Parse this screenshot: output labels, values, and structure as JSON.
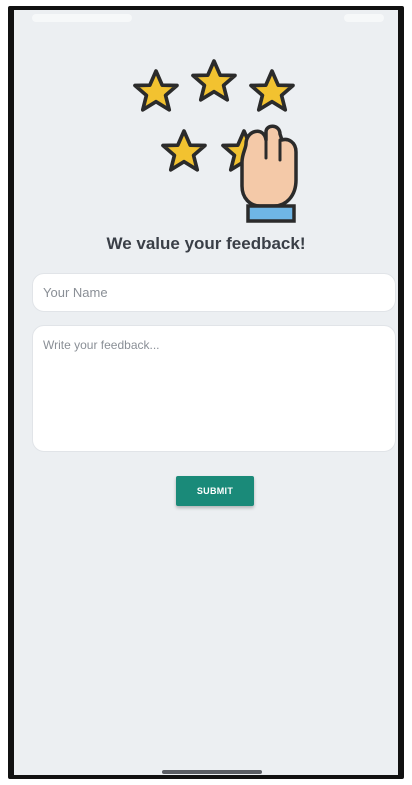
{
  "page": {
    "title": "We value your feedback!"
  },
  "form": {
    "name_placeholder": "Your Name",
    "name_value": "",
    "feedback_placeholder": "Write your feedback...",
    "feedback_value": "",
    "submit_label": "SUBMIT"
  },
  "colors": {
    "background": "#eceff2",
    "accent": "#1a8a79",
    "star": "#f2c230",
    "title_text": "#3a3f47"
  },
  "icons": {
    "hero": "five-stars-rating-hand-icon"
  }
}
